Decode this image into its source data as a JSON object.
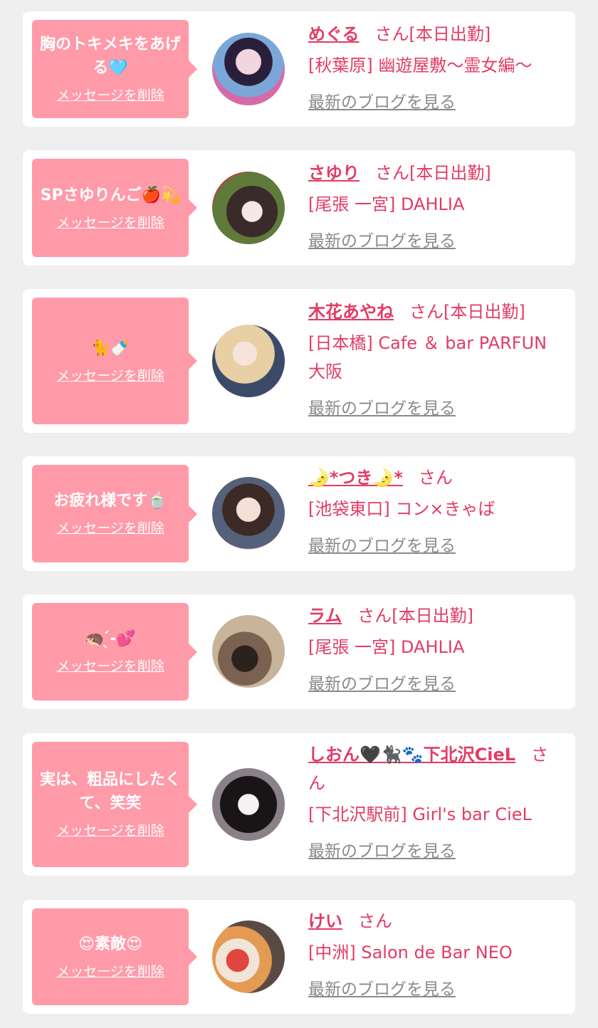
{
  "delete_label": "メッセージを削除",
  "blog_label": "最新のブログを見る",
  "items": [
    {
      "message": "胸のトキメキをあげる🩵",
      "name": "めぐる",
      "suffix": "さん[本日出勤]",
      "shop": "[秋葉原] 幽遊屋敷〜霊女編〜"
    },
    {
      "message": "SPさゆりんご🍎💫",
      "name": "さゆり",
      "suffix": "さん[本日出勤]",
      "shop": "[尾張 一宮] DAHLIA"
    },
    {
      "message": "🐈🍼",
      "name": "木花あやね",
      "suffix": "さん[本日出勤]",
      "shop": "[日本橋] Cafe ＆ bar PARFUN 大阪"
    },
    {
      "message": "お疲れ様です🍵",
      "name": "🌛*つき🌛*",
      "suffix": "さん",
      "shop": "[池袋東口] コン×きゃば"
    },
    {
      "message": "🦔 ̖́-💕",
      "name": "ラム",
      "suffix": "さん[本日出勤]",
      "shop": "[尾張 一宮] DAHLIA"
    },
    {
      "message": "実は、粗品にしたくて、笑笑",
      "name": "しおん🖤🐈‍⬛🐾下北沢CieL",
      "suffix": "さん",
      "shop": "[下北沢駅前] Girl's bar CieL"
    },
    {
      "message": "😍素敵😍",
      "name": "けい",
      "suffix": "さん",
      "shop": "[中洲] Salon de Bar NEO"
    }
  ]
}
